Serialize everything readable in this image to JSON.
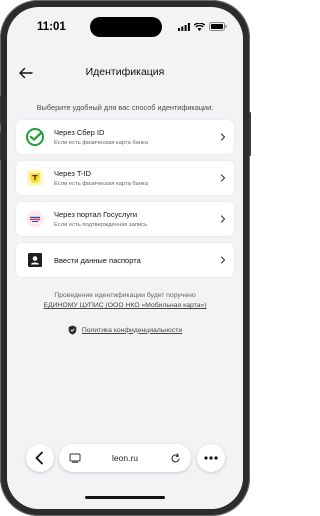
{
  "status_bar": {
    "time": "11:01"
  },
  "header": {
    "title": "Идентификация"
  },
  "subtitle": "Выберите удобный для вас способ идентификации:",
  "options": [
    {
      "title": "Через Сбер ID",
      "desc": "Если есть физическая карта банка",
      "icon": "sber-id-icon",
      "color": "#21a038"
    },
    {
      "title": "Через T-ID",
      "desc": "Если есть физическая карта банка",
      "icon": "tbank-icon",
      "color": "#ffdd2d"
    },
    {
      "title": "Через портал Госуслуги",
      "desc": "Если есть подтвержденная запись",
      "icon": "gosuslugi-icon",
      "color": "#ee3f58"
    },
    {
      "title": "Ввести данные паспорта",
      "icon": "passport-icon"
    }
  ],
  "note": {
    "line1": "Проведение идентификации будет поручено",
    "link": "ЕДИНОМУ ЦУПИС (ООО НКО «Мобильная карта»)"
  },
  "privacy": {
    "label": "Политика конфиденциальности"
  },
  "browser": {
    "url": "leon.ru"
  }
}
